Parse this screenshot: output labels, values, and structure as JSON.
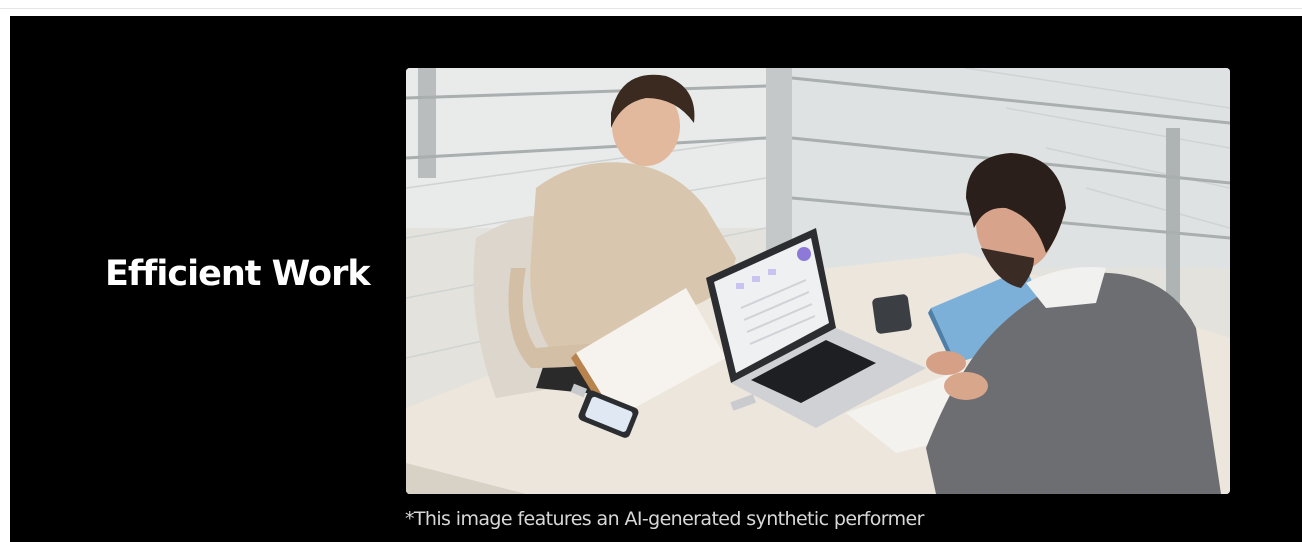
{
  "section": {
    "headline": "Efficient Work",
    "caption": "*This image features an AI-generated synthetic performer"
  },
  "photo": {
    "subject": "meeting-photo"
  },
  "colors": {
    "panel_background": "#000000",
    "headline_text": "#ffffff",
    "caption_text": "#d8d8d8"
  }
}
